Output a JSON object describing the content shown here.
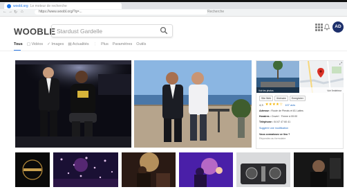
{
  "browser": {
    "tab_title": "woobl.org",
    "tab_subtitle": "Le moteur de recherche",
    "address": "https://www.woobl.org/?q=...",
    "address_right": "Recherche"
  },
  "header": {
    "logo_text": "WOOBLE",
    "search_value": "Stardust Gardelle",
    "avatar_initials": "AD",
    "brand_color": "#2b78e4"
  },
  "tabs": [
    {
      "label": "Tous",
      "active": true
    },
    {
      "label": "Vidéos"
    },
    {
      "label": "Images"
    },
    {
      "label": "Actualités"
    },
    {
      "label": "Plus"
    },
    {
      "label": "Paramètres"
    },
    {
      "label": "Outils"
    }
  ],
  "panel": {
    "buttons": [
      "Site Web",
      "Itinéraire",
      "Enregistrer"
    ],
    "rating": "4,3",
    "stars": "★★★★☆",
    "reviews": "107 avis",
    "address_label": "Adresse :",
    "address_value": "Route de Plerais et 81 Lattes",
    "hours_label": "Horaires :",
    "hours_value": "Ouvert · Ferme à 00:00",
    "phone_label": "Téléphone :",
    "phone_value": "04 67 47 60 41",
    "suggest_edit": "Suggérer une modification",
    "owner_prompt": "Vous connaissez ce lieu ?",
    "owner_link": "Répondez au formulaire",
    "photo_label": "Voir les photos",
    "map_label": "Voir l'extérieur"
  },
  "thumbnails": [
    {
      "name": "thumb-logo"
    },
    {
      "name": "thumb-crowd-lights"
    },
    {
      "name": "thumb-dj-stage"
    },
    {
      "name": "thumb-party-purple"
    },
    {
      "name": "thumb-dj-mixer"
    },
    {
      "name": "thumb-club-dark"
    }
  ]
}
